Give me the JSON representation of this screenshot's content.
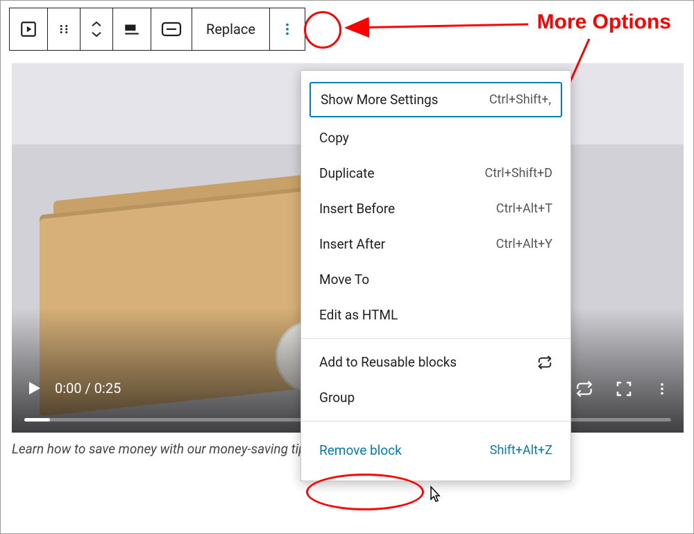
{
  "annotation": {
    "label": "More Options"
  },
  "toolbar": {
    "replace_label": "Replace"
  },
  "video": {
    "time": "0:00 / 0:25"
  },
  "caption": "Learn how to save money with our money-saving tips",
  "menu": {
    "items": [
      {
        "label": "Show More Settings",
        "shortcut": "Ctrl+Shift+,"
      },
      {
        "label": "Copy",
        "shortcut": ""
      },
      {
        "label": "Duplicate",
        "shortcut": "Ctrl+Shift+D"
      },
      {
        "label": "Insert Before",
        "shortcut": "Ctrl+Alt+T"
      },
      {
        "label": "Insert After",
        "shortcut": "Ctrl+Alt+Y"
      },
      {
        "label": "Move To",
        "shortcut": ""
      },
      {
        "label": "Edit as HTML",
        "shortcut": ""
      }
    ],
    "group2": [
      {
        "label": "Add to Reusable blocks",
        "icon": "refresh"
      },
      {
        "label": "Group",
        "icon": ""
      }
    ],
    "remove": {
      "label": "Remove block",
      "shortcut": "Shift+Alt+Z"
    }
  }
}
